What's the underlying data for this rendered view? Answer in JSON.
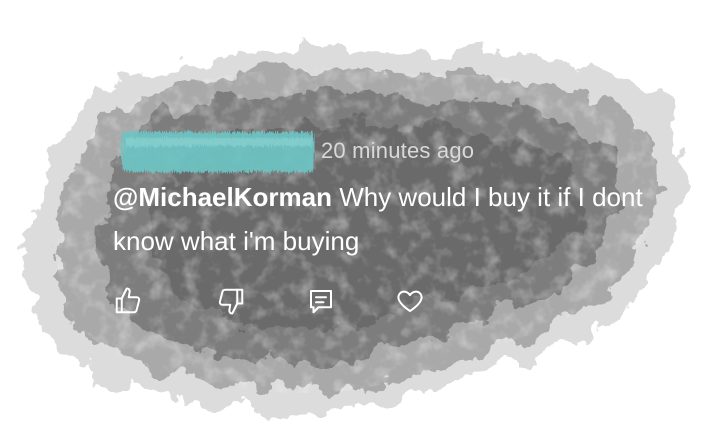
{
  "comment": {
    "timestamp": "20 minutes ago",
    "mention": "@MichaelKorman",
    "text": "Why would I buy it if I dont know what i'm buying",
    "username_redacted": true
  },
  "actions": {
    "like_icon": "thumbs-up-icon",
    "dislike_icon": "thumbs-down-icon",
    "reply_icon": "comment-icon",
    "heart_icon": "heart-icon"
  },
  "colors": {
    "ink": "#6e6e6e",
    "redaction": "#6ec4c4",
    "text": "#ffffff",
    "timestamp": "#d9d9d9"
  }
}
